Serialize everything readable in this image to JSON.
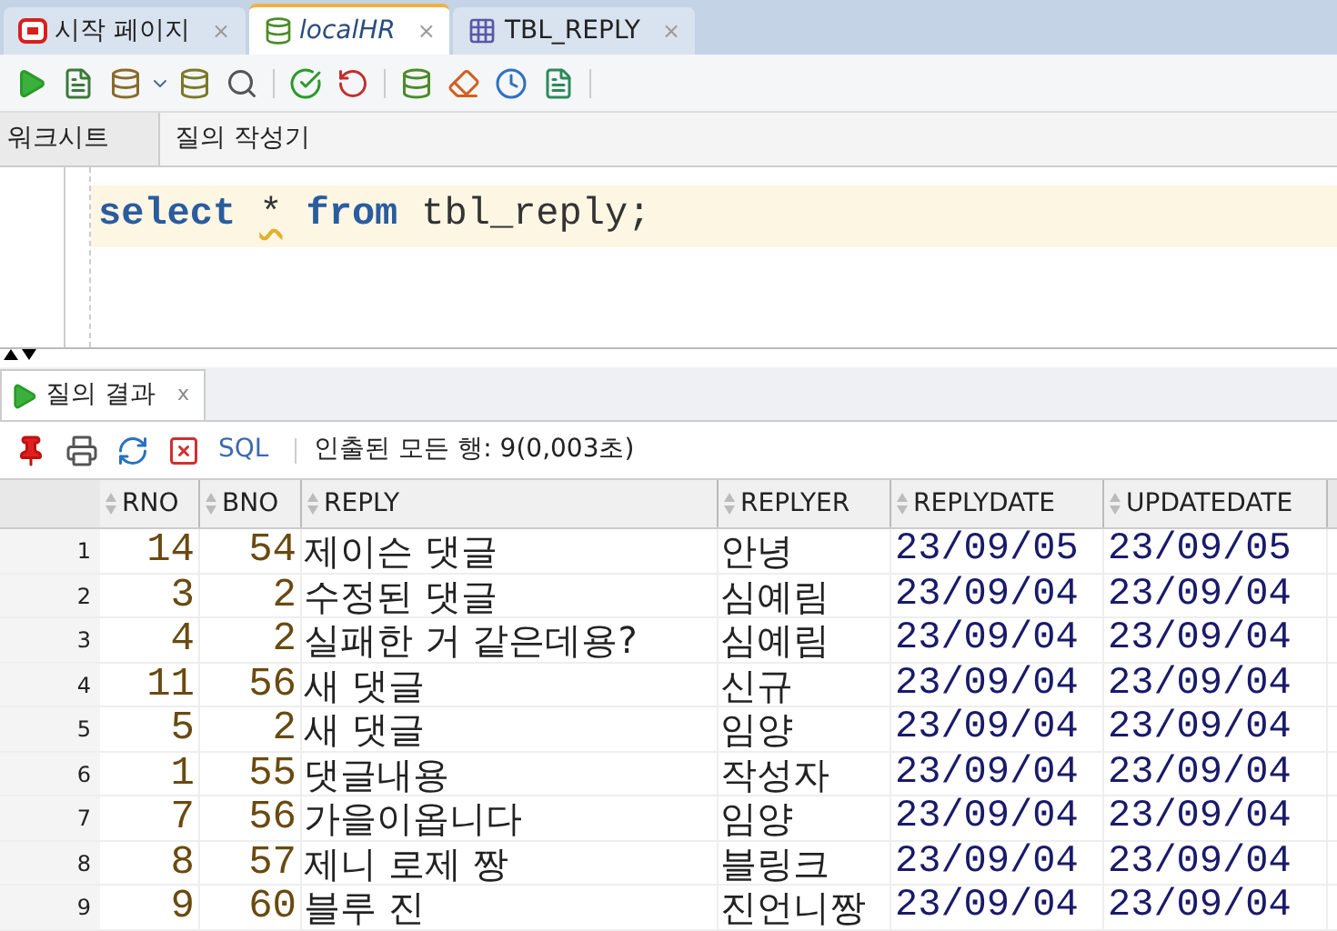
{
  "tabs": [
    {
      "label": "시작 페이지",
      "kind": "start",
      "selected": false,
      "close": "×"
    },
    {
      "label": "localHR",
      "kind": "sql",
      "selected": true,
      "close": "×"
    },
    {
      "label": "TBL_REPLY",
      "kind": "table",
      "selected": false,
      "close": "×"
    }
  ],
  "subtabs": [
    {
      "label": "워크시트",
      "selected": true
    },
    {
      "label": "질의 작성기",
      "selected": false
    }
  ],
  "editor": {
    "tokens": [
      {
        "text": "select",
        "kind": "keyword"
      },
      {
        "text": "*",
        "kind": "warning"
      },
      {
        "text": "from",
        "kind": "keyword"
      },
      {
        "text": "tbl_reply;",
        "kind": "plain"
      }
    ]
  },
  "result_tab": {
    "label": "질의 결과",
    "close": "x"
  },
  "result_toolbar": {
    "sql_label": "SQL",
    "status": "인출된 모든 행: 9(0,003초)"
  },
  "table": {
    "columns": [
      "",
      "RNO",
      "BNO",
      "REPLY",
      "REPLYER",
      "REPLYDATE",
      "UPDATEDATE"
    ],
    "rows": [
      [
        "1",
        "14",
        "54",
        "제이슨 댓글",
        "안녕",
        "23/09/05",
        "23/09/05"
      ],
      [
        "2",
        "3",
        "2",
        "수정된 댓글",
        "심예림",
        "23/09/04",
        "23/09/04"
      ],
      [
        "3",
        "4",
        "2",
        "실패한 거 같은데용?",
        "심예림",
        "23/09/04",
        "23/09/04"
      ],
      [
        "4",
        "11",
        "56",
        "새 댓글",
        "신규",
        "23/09/04",
        "23/09/04"
      ],
      [
        "5",
        "5",
        "2",
        "새 댓글",
        "임양",
        "23/09/04",
        "23/09/04"
      ],
      [
        "6",
        "1",
        "55",
        "댓글내용",
        "작성자",
        "23/09/04",
        "23/09/04"
      ],
      [
        "7",
        "7",
        "56",
        "가을이옵니다",
        "임양",
        "23/09/04",
        "23/09/04"
      ],
      [
        "8",
        "8",
        "57",
        "제니 로제 짱",
        "블링크",
        "23/09/04",
        "23/09/04"
      ],
      [
        "9",
        "9",
        "60",
        "블루 진",
        "진언니짱",
        "23/09/04",
        "23/09/04"
      ]
    ]
  }
}
